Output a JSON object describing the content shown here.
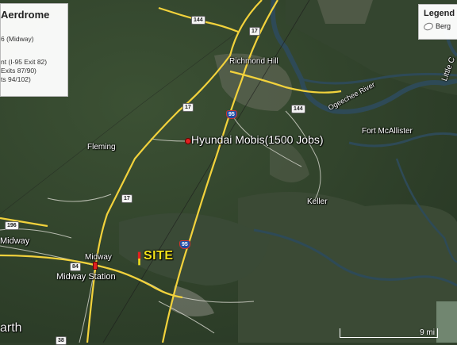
{
  "info_panel": {
    "title": "Aerdrome",
    "lines": [
      "6 (Midway)",
      "nt (I-95 Exit 82)",
      "Exits 87/90)",
      "ts 94/102)"
    ]
  },
  "legend": {
    "title": "Legend",
    "items": [
      "Berg"
    ]
  },
  "places": {
    "richmond_hill": "Richmond Hill",
    "fleming": "Fleming",
    "fort_mcallister": "Fort McAllister",
    "keller": "Keller",
    "midway_town": "Midway",
    "midway_left": "Midway",
    "midway_station": "Midway Station",
    "little": "Little C",
    "ogeechee_river": "Ogeechee River",
    "earth": "arth"
  },
  "markers": {
    "hyundai": "Hyundai Mobis(1500 Jobs)",
    "site": "SITE"
  },
  "shields": {
    "us17_a": "17",
    "us17_b": "17",
    "i95_a": "95",
    "i95_b": "95",
    "sr144_a": "144",
    "sr144_b": "144",
    "us17_c": "17",
    "sr84": "84",
    "sr196": "196",
    "sr38": "38"
  },
  "scale": {
    "label": "9 mi"
  },
  "colors": {
    "road": "#f2d23c",
    "site": "#f3e21a",
    "marker": "#e02020",
    "river": "#2e4a57"
  }
}
